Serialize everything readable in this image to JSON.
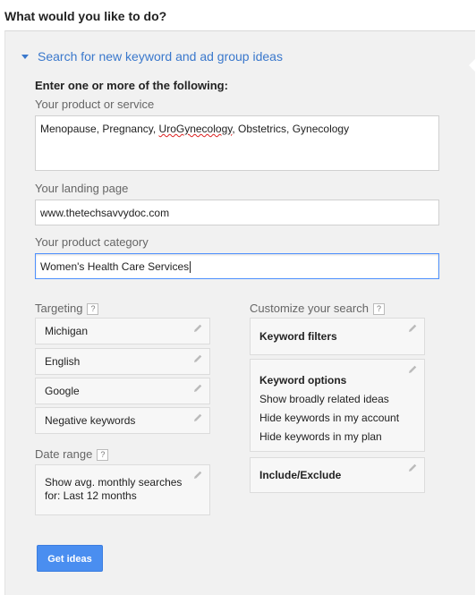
{
  "page": {
    "heading": "What would you like to do?"
  },
  "section": {
    "title": "Search for new keyword and ad group ideas"
  },
  "form": {
    "instruction": "Enter one or more of the following:",
    "product_label": "Your product or service",
    "product_value_before": "Menopause, Pregnancy, ",
    "product_value_misspelled": "UroGynecology",
    "product_value_after": ", Obstetrics, Gynecology",
    "landing_label": "Your landing page",
    "landing_value": "www.thetechsavvydoc.com",
    "category_label": "Your product category",
    "category_value": "Women's Health Care Services"
  },
  "targeting": {
    "label": "Targeting",
    "help": "?",
    "items": [
      "Michigan",
      "English",
      "Google",
      "Negative keywords"
    ]
  },
  "date_range": {
    "label": "Date range",
    "help": "?",
    "line1": "Show avg. monthly searches",
    "line2": "for: Last 12 months"
  },
  "customize": {
    "label": "Customize your search",
    "help": "?",
    "keyword_filters": "Keyword filters",
    "keyword_options": {
      "title": "Keyword options",
      "lines": [
        "Show broadly related ideas",
        "Hide keywords in my account",
        "Hide keywords in my plan"
      ]
    },
    "include_exclude": "Include/Exclude"
  },
  "actions": {
    "get_ideas": "Get ideas"
  },
  "colors": {
    "accent": "#3a78cc",
    "button": "#4a8ef0",
    "panel": "#f1f1f1",
    "focus": "#4d90fe"
  }
}
